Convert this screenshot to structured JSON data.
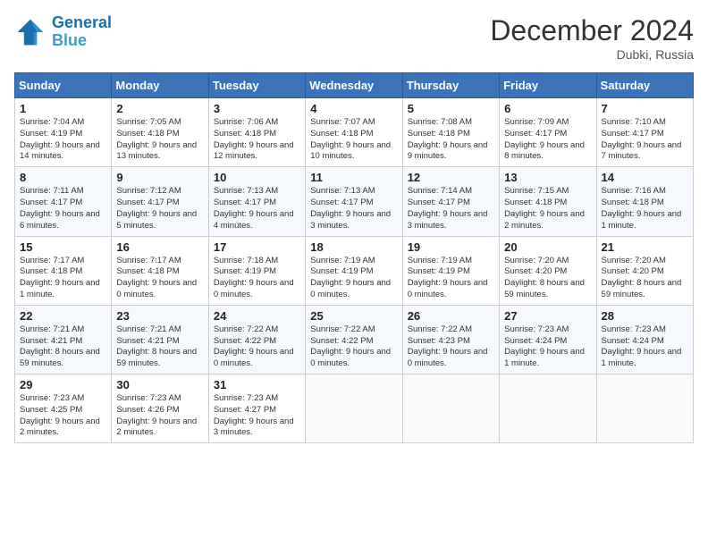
{
  "header": {
    "logo_line1": "General",
    "logo_line2": "Blue",
    "month_title": "December 2024",
    "location": "Dubki, Russia"
  },
  "days_of_week": [
    "Sunday",
    "Monday",
    "Tuesday",
    "Wednesday",
    "Thursday",
    "Friday",
    "Saturday"
  ],
  "weeks": [
    [
      {
        "day": 1,
        "sunrise": "7:04 AM",
        "sunset": "4:19 PM",
        "daylight": "9 hours and 14 minutes."
      },
      {
        "day": 2,
        "sunrise": "7:05 AM",
        "sunset": "4:18 PM",
        "daylight": "9 hours and 13 minutes."
      },
      {
        "day": 3,
        "sunrise": "7:06 AM",
        "sunset": "4:18 PM",
        "daylight": "9 hours and 12 minutes."
      },
      {
        "day": 4,
        "sunrise": "7:07 AM",
        "sunset": "4:18 PM",
        "daylight": "9 hours and 10 minutes."
      },
      {
        "day": 5,
        "sunrise": "7:08 AM",
        "sunset": "4:18 PM",
        "daylight": "9 hours and 9 minutes."
      },
      {
        "day": 6,
        "sunrise": "7:09 AM",
        "sunset": "4:17 PM",
        "daylight": "9 hours and 8 minutes."
      },
      {
        "day": 7,
        "sunrise": "7:10 AM",
        "sunset": "4:17 PM",
        "daylight": "9 hours and 7 minutes."
      }
    ],
    [
      {
        "day": 8,
        "sunrise": "7:11 AM",
        "sunset": "4:17 PM",
        "daylight": "9 hours and 6 minutes."
      },
      {
        "day": 9,
        "sunrise": "7:12 AM",
        "sunset": "4:17 PM",
        "daylight": "9 hours and 5 minutes."
      },
      {
        "day": 10,
        "sunrise": "7:13 AM",
        "sunset": "4:17 PM",
        "daylight": "9 hours and 4 minutes."
      },
      {
        "day": 11,
        "sunrise": "7:13 AM",
        "sunset": "4:17 PM",
        "daylight": "9 hours and 3 minutes."
      },
      {
        "day": 12,
        "sunrise": "7:14 AM",
        "sunset": "4:17 PM",
        "daylight": "9 hours and 3 minutes."
      },
      {
        "day": 13,
        "sunrise": "7:15 AM",
        "sunset": "4:18 PM",
        "daylight": "9 hours and 2 minutes."
      },
      {
        "day": 14,
        "sunrise": "7:16 AM",
        "sunset": "4:18 PM",
        "daylight": "9 hours and 1 minute."
      }
    ],
    [
      {
        "day": 15,
        "sunrise": "7:17 AM",
        "sunset": "4:18 PM",
        "daylight": "9 hours and 1 minute."
      },
      {
        "day": 16,
        "sunrise": "7:17 AM",
        "sunset": "4:18 PM",
        "daylight": "9 hours and 0 minutes."
      },
      {
        "day": 17,
        "sunrise": "7:18 AM",
        "sunset": "4:19 PM",
        "daylight": "9 hours and 0 minutes."
      },
      {
        "day": 18,
        "sunrise": "7:19 AM",
        "sunset": "4:19 PM",
        "daylight": "9 hours and 0 minutes."
      },
      {
        "day": 19,
        "sunrise": "7:19 AM",
        "sunset": "4:19 PM",
        "daylight": "9 hours and 0 minutes."
      },
      {
        "day": 20,
        "sunrise": "7:20 AM",
        "sunset": "4:20 PM",
        "daylight": "8 hours and 59 minutes."
      },
      {
        "day": 21,
        "sunrise": "7:20 AM",
        "sunset": "4:20 PM",
        "daylight": "8 hours and 59 minutes."
      }
    ],
    [
      {
        "day": 22,
        "sunrise": "7:21 AM",
        "sunset": "4:21 PM",
        "daylight": "8 hours and 59 minutes."
      },
      {
        "day": 23,
        "sunrise": "7:21 AM",
        "sunset": "4:21 PM",
        "daylight": "8 hours and 59 minutes."
      },
      {
        "day": 24,
        "sunrise": "7:22 AM",
        "sunset": "4:22 PM",
        "daylight": "9 hours and 0 minutes."
      },
      {
        "day": 25,
        "sunrise": "7:22 AM",
        "sunset": "4:22 PM",
        "daylight": "9 hours and 0 minutes."
      },
      {
        "day": 26,
        "sunrise": "7:22 AM",
        "sunset": "4:23 PM",
        "daylight": "9 hours and 0 minutes."
      },
      {
        "day": 27,
        "sunrise": "7:23 AM",
        "sunset": "4:24 PM",
        "daylight": "9 hours and 1 minute."
      },
      {
        "day": 28,
        "sunrise": "7:23 AM",
        "sunset": "4:24 PM",
        "daylight": "9 hours and 1 minute."
      }
    ],
    [
      {
        "day": 29,
        "sunrise": "7:23 AM",
        "sunset": "4:25 PM",
        "daylight": "9 hours and 2 minutes."
      },
      {
        "day": 30,
        "sunrise": "7:23 AM",
        "sunset": "4:26 PM",
        "daylight": "9 hours and 2 minutes."
      },
      {
        "day": 31,
        "sunrise": "7:23 AM",
        "sunset": "4:27 PM",
        "daylight": "9 hours and 3 minutes."
      },
      null,
      null,
      null,
      null
    ]
  ]
}
